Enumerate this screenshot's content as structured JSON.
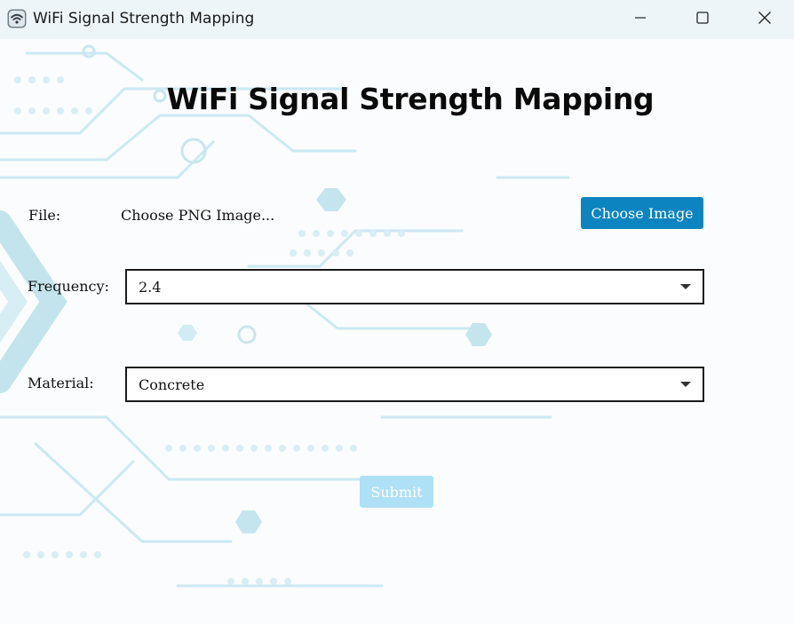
{
  "window": {
    "title": "WiFi Signal Strength Mapping",
    "app_icon": "wifi-icon",
    "controls": {
      "minimize_icon": "minimize-icon",
      "maximize_icon": "maximize-icon",
      "close_icon": "close-icon"
    }
  },
  "main": {
    "heading": "WiFi Signal Strength Mapping",
    "file": {
      "label": "File:",
      "value": "Choose PNG Image...",
      "button_label": "Choose Image"
    },
    "frequency": {
      "label": "Frequency:",
      "selected": "2.4"
    },
    "material": {
      "label": "Material:",
      "selected": "Concrete"
    },
    "submit_label": "Submit"
  },
  "colors": {
    "primary_button": "#0b84c0",
    "disabled_button": "#aee0f6",
    "titlebar": "#eef5f9",
    "background_circuit": "#bfe3ec"
  }
}
